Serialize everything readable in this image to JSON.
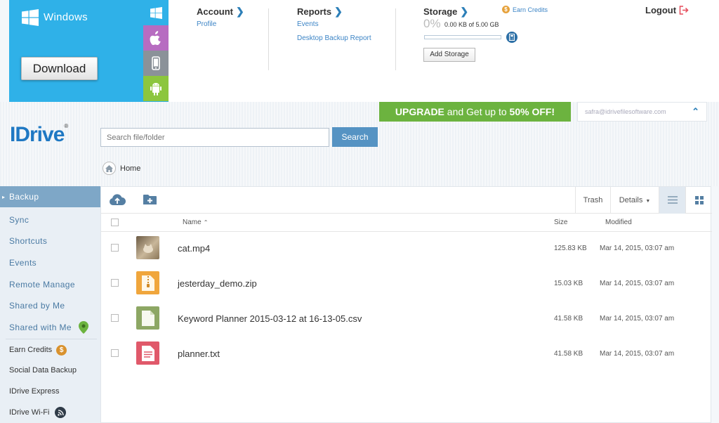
{
  "download": {
    "os_label": "Windows",
    "button": "Download"
  },
  "nav": {
    "account": {
      "title": "Account",
      "links": [
        "Profile"
      ]
    },
    "reports": {
      "title": "Reports",
      "links": [
        "Events",
        "Desktop Backup Report"
      ]
    },
    "storage": {
      "title": "Storage",
      "percent_label": "0%",
      "usage": "0.00 KB of 5.00 GB",
      "used_fraction": 0,
      "add_button": "Add Storage"
    },
    "earn_credits": "Earn Credits",
    "logout": "Logout"
  },
  "banner": {
    "upgrade_bold": "UPGRADE",
    "upgrade_text": " and Get up to ",
    "upgrade_offer": "50% OFF!",
    "user_email": "safra@idrivefilesoftware.com"
  },
  "brand": {
    "logo": "IDrive"
  },
  "search": {
    "placeholder": "Search file/folder",
    "button": "Search"
  },
  "breadcrumb": {
    "home": "Home"
  },
  "sidebar": {
    "items": [
      "Backup",
      "Sync",
      "Shortcuts",
      "Events",
      "Remote Manage",
      "Shared by Me",
      "Shared with Me"
    ],
    "extras": [
      "Earn Credits",
      "Social Data Backup",
      "IDrive Express",
      "IDrive Wi-Fi"
    ]
  },
  "toolbar": {
    "trash": "Trash",
    "details": "Details"
  },
  "table": {
    "headers": {
      "name": "Name",
      "size": "Size",
      "modified": "Modified"
    },
    "rows": [
      {
        "name": "cat.mp4",
        "size": "125.83 KB",
        "modified": "Mar 14, 2015, 03:07 am"
      },
      {
        "name": "jesterday_demo.zip",
        "size": "15.03 KB",
        "modified": "Mar 14, 2015, 03:07 am"
      },
      {
        "name": "Keyword Planner 2015-03-12 at 16-13-05.csv",
        "size": "41.58 KB",
        "modified": "Mar 14, 2015, 03:07 am"
      },
      {
        "name": "planner.txt",
        "size": "41.58 KB",
        "modified": "Mar 14, 2015, 03:07 am"
      }
    ]
  },
  "colors": {
    "accent": "#2fb1e8",
    "brand_blue": "#1f78c3",
    "upgrade_green": "#6cb33f",
    "sidebar_active": "#7ea7c7"
  }
}
